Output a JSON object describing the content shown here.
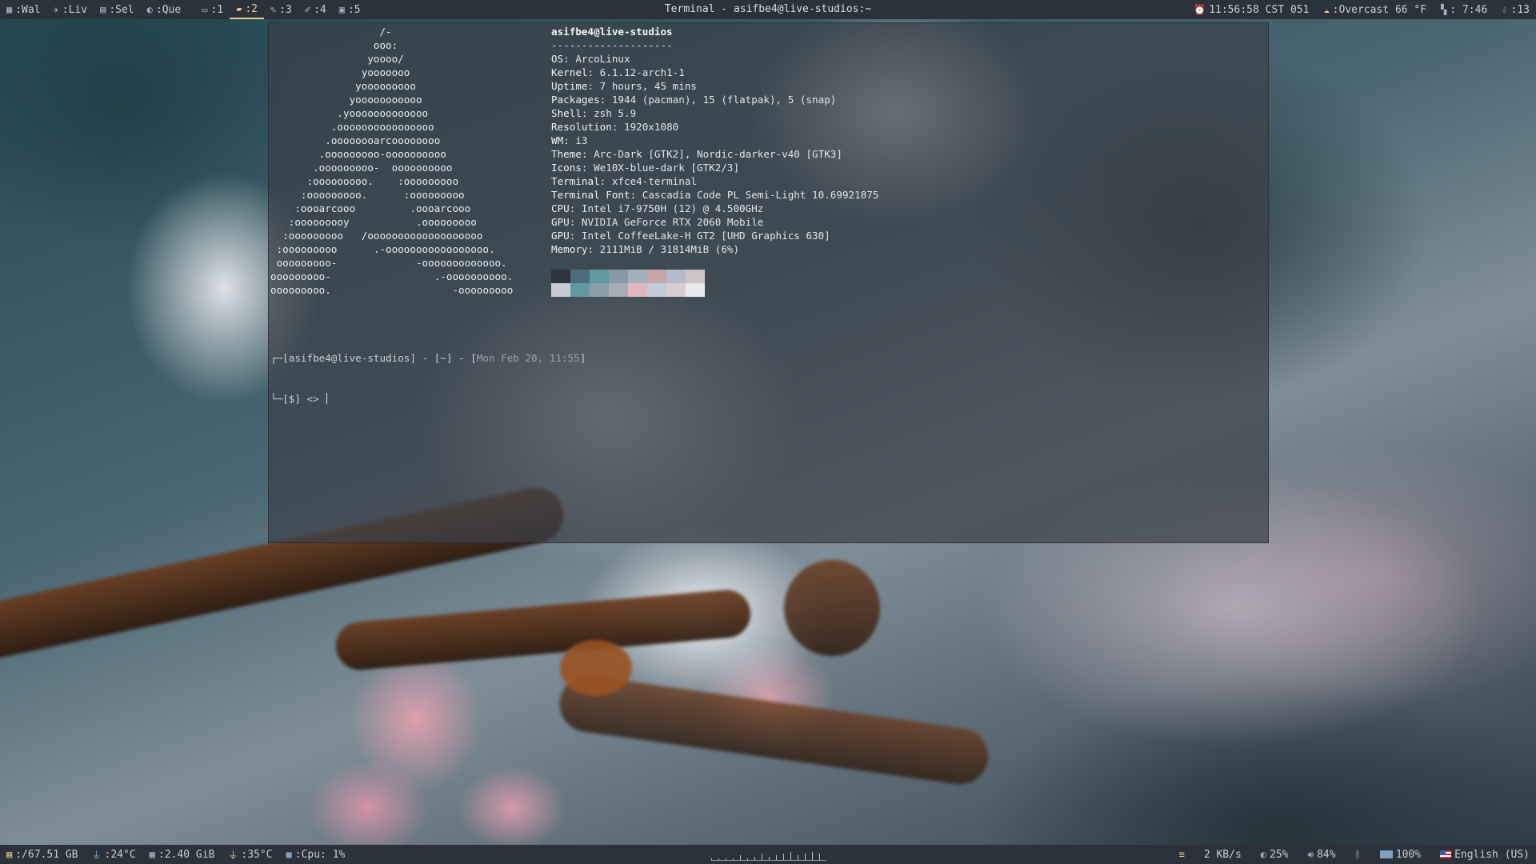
{
  "window_title": "Terminal - asifbe4@live-studios:~",
  "workspaces": [
    {
      "icon": "grid-icon",
      "glyph": "▦",
      "label": ":Wal"
    },
    {
      "icon": "rocket-icon",
      "glyph": "✈",
      "label": ":Liv"
    },
    {
      "icon": "list-icon",
      "glyph": "▤",
      "label": ":Sel"
    },
    {
      "icon": "moon-icon",
      "glyph": "◐",
      "label": ":Que"
    },
    {
      "icon": "monitor-icon",
      "glyph": "▭",
      "label": ":1"
    },
    {
      "icon": "folder-icon",
      "glyph": "▰",
      "label": ":2",
      "focused": true
    },
    {
      "icon": "pen-icon",
      "glyph": "✎",
      "label": ":3"
    },
    {
      "icon": "brush-icon",
      "glyph": "✐",
      "label": ":4"
    },
    {
      "icon": "image-icon",
      "glyph": "▣",
      "label": ":5"
    }
  ],
  "top_status": {
    "clock": "11:56:58 CST 051",
    "weather": ":Overcast 66 °F",
    "uptime": ": 7:46",
    "updates": ":13"
  },
  "neofetch": {
    "ascii": [
      "                  /-",
      "                 ooo:",
      "                yoooo/",
      "               yooooooo",
      "              yooooooooo",
      "             yooooooooooo",
      "           .yooooooooooooo",
      "          .oooooooooooooooo",
      "         .oooooooarcoooooooo",
      "        .ooooooooo-oooooooooo",
      "       .ooooooooo-  oooooooooo",
      "      :ooooooooo.    :ooooooooo",
      "     :ooooooooo.      :ooooooooo",
      "    :oooarcooo         .oooarcooo",
      "   :ooooooooy           .ooooooooo",
      "  :ooooooooo   /ooooooooooooooooooo",
      " :ooooooooo      .-ooooooooooooooooo.",
      " ooooooooo-             -ooooooooooooo.",
      "ooooooooo-                 .-oooooooooo.",
      "ooooooooo.                    -ooooooooo"
    ],
    "user_host": "asifbe4@live-studios",
    "separator": "--------------------",
    "fields": [
      {
        "key": "OS",
        "value": "ArcoLinux"
      },
      {
        "key": "Kernel",
        "value": "6.1.12-arch1-1"
      },
      {
        "key": "Uptime",
        "value": "7 hours, 45 mins"
      },
      {
        "key": "Packages",
        "value": "1944 (pacman), 15 (flatpak), 5 (snap)"
      },
      {
        "key": "Shell",
        "value": "zsh 5.9"
      },
      {
        "key": "Resolution",
        "value": "1920x1080"
      },
      {
        "key": "WM",
        "value": "i3"
      },
      {
        "key": "Theme",
        "value": "Arc-Dark [GTK2], Nordic-darker-v40 [GTK3]"
      },
      {
        "key": "Icons",
        "value": "We10X-blue-dark [GTK2/3]"
      },
      {
        "key": "Terminal",
        "value": "xfce4-terminal"
      },
      {
        "key": "Terminal Font",
        "value": "Cascadia Code PL Semi-Light 10.69921875"
      },
      {
        "key": "CPU",
        "value": "Intel i7-9750H (12) @ 4.500GHz"
      },
      {
        "key": "GPU",
        "value": "NVIDIA GeForce RTX 2060 Mobile"
      },
      {
        "key": "GPU",
        "value": "Intel CoffeeLake-H GT2 [UHD Graphics 630]"
      },
      {
        "key": "Memory",
        "value": "2111MiB / 31814MiB (6%)"
      }
    ],
    "palette_dark": [
      "#2e3440",
      "#4d6b78",
      "#5f9aa2",
      "#889aa7",
      "#a6b0bb",
      "#c9a3aa",
      "#b3bcc8",
      "#cfc3c8"
    ],
    "palette_light": [
      "#c7cbd1",
      "#5f9aa2",
      "#8b9da9",
      "#a5adb7",
      "#e2b7bd",
      "#c4cbd5",
      "#d9ccd1",
      "#e8e9ec"
    ]
  },
  "prompt": {
    "line1_prefix": "┌─[asifbe4@live-studios] - [~] - [",
    "date": "Mon Feb 20, 11:55",
    "line1_suffix": "]",
    "line2": "└─[$] <> "
  },
  "bottom_status": {
    "disk": ":/67.51 GB",
    "temp1": ":24°C",
    "memory": ":2.40 GiB",
    "temp2": ":35°C",
    "cpu": ":Cpu: 1%",
    "network": "2 KB/s",
    "brightness": "25%",
    "volume": "84%",
    "battery": "100%",
    "keyboard": "English (US)"
  },
  "colors": {
    "bar_bg": "#2b323c",
    "accent": "#ebcb8b",
    "icon_blue": "#81a1c1"
  }
}
